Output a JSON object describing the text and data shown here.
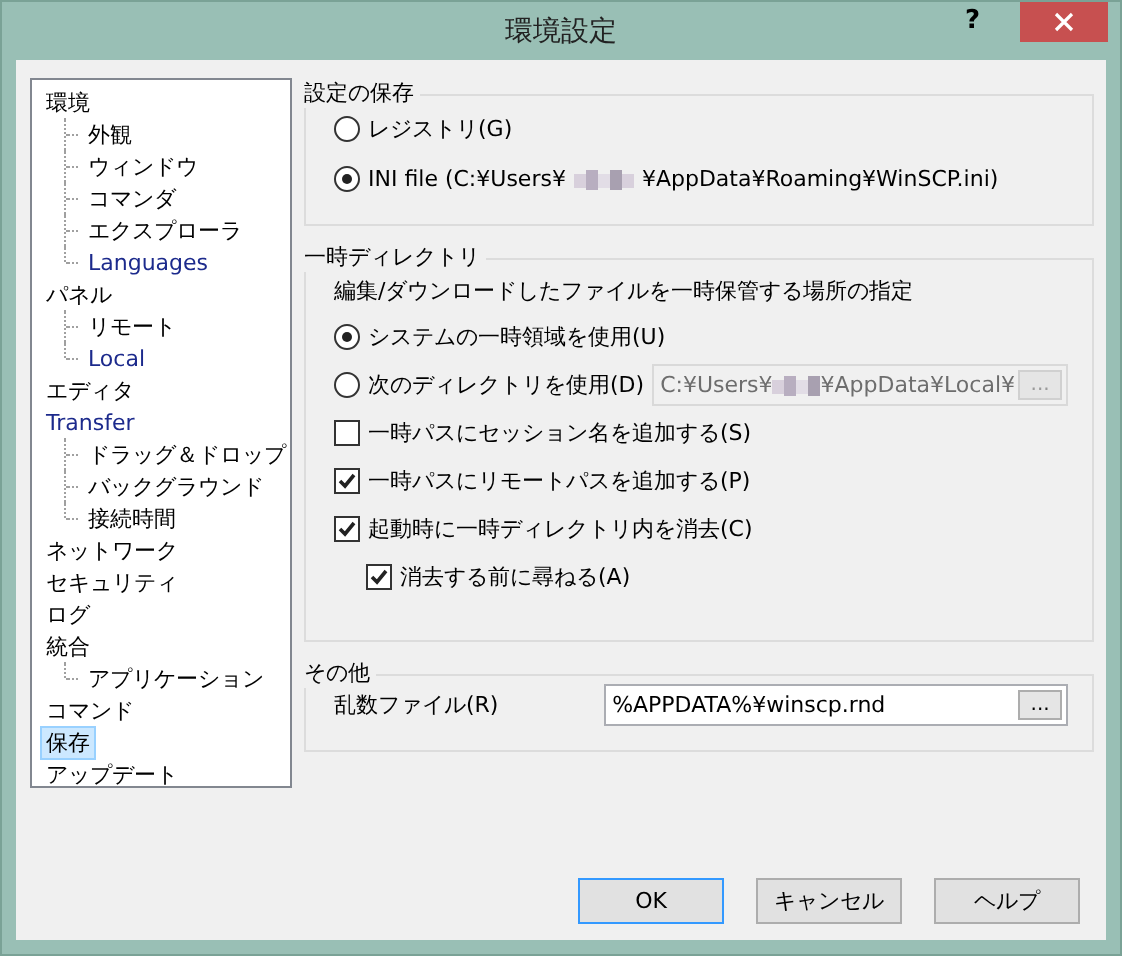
{
  "window": {
    "title": "環境設定",
    "help": "?"
  },
  "tree": [
    {
      "label": "環境",
      "color": "#000000",
      "selected": false,
      "children": [
        {
          "label": "外観",
          "color": "#000000",
          "selected": false
        },
        {
          "label": "ウィンドウ",
          "color": "#000000",
          "selected": false
        },
        {
          "label": "コマンダ",
          "color": "#000000",
          "selected": false
        },
        {
          "label": "エクスプローラ",
          "color": "#000000",
          "selected": false
        },
        {
          "label": "Languages",
          "color": "#1c2a8c",
          "selected": false
        }
      ]
    },
    {
      "label": "パネル",
      "color": "#000000",
      "selected": false,
      "children": [
        {
          "label": "リモート",
          "color": "#000000",
          "selected": false
        },
        {
          "label": "Local",
          "color": "#1c2a8c",
          "selected": false
        }
      ]
    },
    {
      "label": "エディタ",
      "color": "#000000",
      "selected": false
    },
    {
      "label": "Transfer",
      "color": "#1c2a8c",
      "selected": false,
      "children": [
        {
          "label": "ドラッグ＆ドロップ",
          "color": "#000000",
          "selected": false
        },
        {
          "label": "バックグラウンド",
          "color": "#000000",
          "selected": false
        },
        {
          "label": "接続時間",
          "color": "#000000",
          "selected": false
        }
      ]
    },
    {
      "label": "ネットワーク",
      "color": "#000000",
      "selected": false
    },
    {
      "label": "セキュリティ",
      "color": "#000000",
      "selected": false
    },
    {
      "label": "ログ",
      "color": "#000000",
      "selected": false
    },
    {
      "label": "統合",
      "color": "#000000",
      "selected": false,
      "children": [
        {
          "label": "アプリケーション",
          "color": "#000000",
          "selected": false
        }
      ]
    },
    {
      "label": "コマンド",
      "color": "#000000",
      "selected": false
    },
    {
      "label": "保存",
      "color": "#000000",
      "selected": true
    },
    {
      "label": "アップデート",
      "color": "#000000",
      "selected": false
    }
  ],
  "storage": {
    "title": "設定の保存",
    "options": [
      {
        "label_parts": [
          "レジストリ(G)"
        ],
        "selected": false
      },
      {
        "label_parts": [
          "INI file (C:¥Users¥",
          "¥AppData¥Roaming¥WinSCP.ini)"
        ],
        "selected": true
      }
    ]
  },
  "temp": {
    "title": "一時ディレクトリ",
    "description": "編集/ダウンロードしたファイルを一時保管する場所の指定",
    "options": [
      {
        "label": "システムの一時領域を使用(U)",
        "selected": true
      },
      {
        "label": "次のディレクトリを使用(D)",
        "selected": false
      }
    ],
    "path_field": {
      "value_parts": [
        "C:¥Users¥",
        "¥AppData¥Local¥"
      ],
      "disabled": true,
      "browse": "..."
    },
    "checks": [
      {
        "label": "一時パスにセッション名を追加する(S)",
        "checked": false
      },
      {
        "label": "一時パスにリモートパスを追加する(P)",
        "checked": true
      },
      {
        "label": "起動時に一時ディレクトリ内を消去(C)",
        "checked": true,
        "children": [
          {
            "label": "消去する前に尋ねる(A)",
            "checked": true
          }
        ]
      }
    ]
  },
  "other": {
    "title": "その他",
    "label": "乱数ファイル(R)",
    "value": "%APPDATA%¥winscp.rnd",
    "browse": "..."
  },
  "buttons": [
    {
      "label": "OK",
      "default": true
    },
    {
      "label": "キャンセル",
      "default": false
    },
    {
      "label": "ヘルプ",
      "default": false
    }
  ]
}
